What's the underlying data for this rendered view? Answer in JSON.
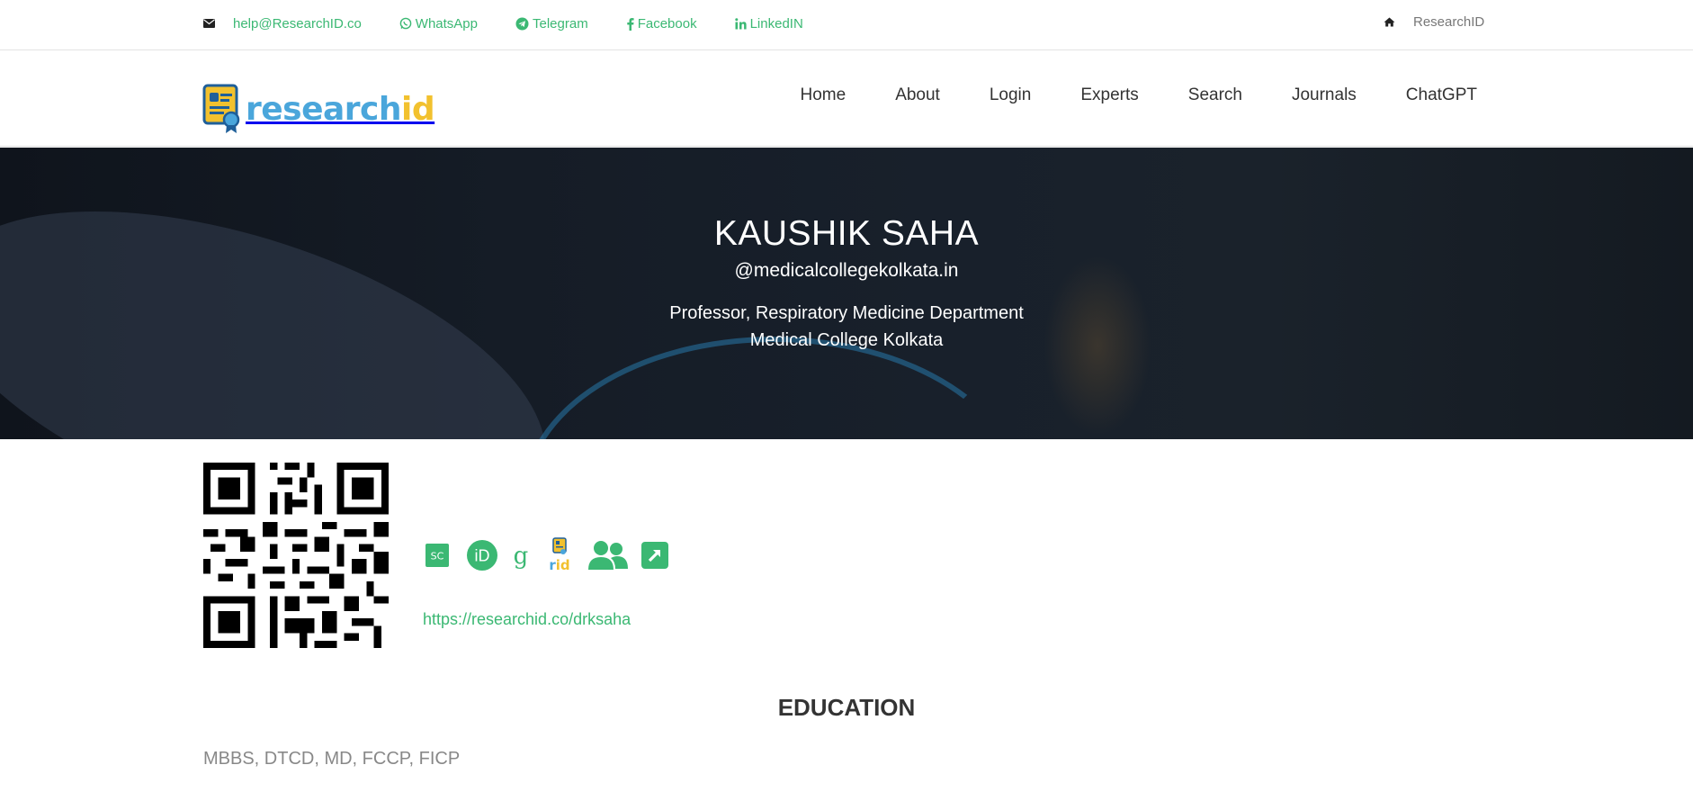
{
  "topbar": {
    "email": "help@ResearchID.co",
    "links": [
      {
        "label": "WhatsApp",
        "icon": "whatsapp-icon"
      },
      {
        "label": "Telegram",
        "icon": "telegram-icon"
      },
      {
        "label": "Facebook",
        "icon": "facebook-icon"
      },
      {
        "label": "LinkedIN",
        "icon": "linkedin-icon"
      }
    ],
    "home_label": "ResearchID"
  },
  "logo": {
    "part1": "research",
    "part2": "id"
  },
  "nav": [
    "Home",
    "About",
    "Login",
    "Experts",
    "Search",
    "Journals",
    "ChatGPT"
  ],
  "profile": {
    "name": "KAUSHIK SAHA",
    "handle": "@medicalcollegekolkata.in",
    "role": "Professor, Respiratory Medicine Department",
    "organization": "Medical College Kolkata",
    "url": "https://researchid.co/drksaha",
    "link_icons": [
      {
        "name": "scopus-icon",
        "text": "SC"
      },
      {
        "name": "orcid-icon",
        "text": "iD"
      },
      {
        "name": "google-scholar-icon",
        "text": "g"
      },
      {
        "name": "researchid-icon",
        "text": "rid"
      },
      {
        "name": "people-icon",
        "text": ""
      },
      {
        "name": "external-link-icon",
        "text": ""
      }
    ]
  },
  "education": {
    "title": "EDUCATION",
    "text": "MBBS, DTCD, MD, FCCP, FICP"
  },
  "colors": {
    "accent": "#3bb873",
    "logo_blue": "#4aa6db",
    "logo_yellow": "#f2c12e",
    "hero_bg": "#151c26"
  }
}
